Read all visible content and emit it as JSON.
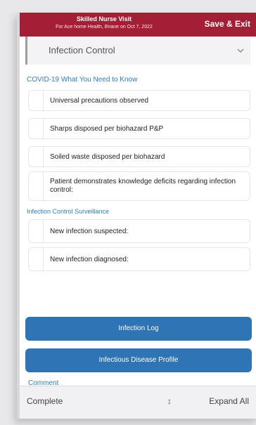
{
  "header": {
    "title": "Skilled Nurse Visit",
    "subtitle": "For Ace home Health, Briane on Oct 7, 2022",
    "save_exit": "Save & Exit"
  },
  "section": {
    "title": "Infection Control",
    "expander_icon": "chevron-down-icon"
  },
  "covid_link": "COVID-19 What You Need to Know",
  "checklist": [
    "Universal precautions observed",
    "Sharps disposed per biohazard P&P",
    "Soiled waste disposed per biohazard",
    "Patient demonstrates knowledge deficits regarding infection control:"
  ],
  "surveillance": {
    "title": "Infection Control Surveillance",
    "items": [
      "New infection suspected:",
      "New infection diagnosed:"
    ]
  },
  "buttons": {
    "infection_log": "Infection Log",
    "infectious_disease_profile": "Infectious Disease Profile"
  },
  "comment_label": "Comment",
  "footer": {
    "status": "Complete",
    "expand_all": "Expand All"
  },
  "colors": {
    "header_bg": "#a41e35",
    "button_bg": "#2f74b5",
    "link": "#2d7dc2"
  }
}
